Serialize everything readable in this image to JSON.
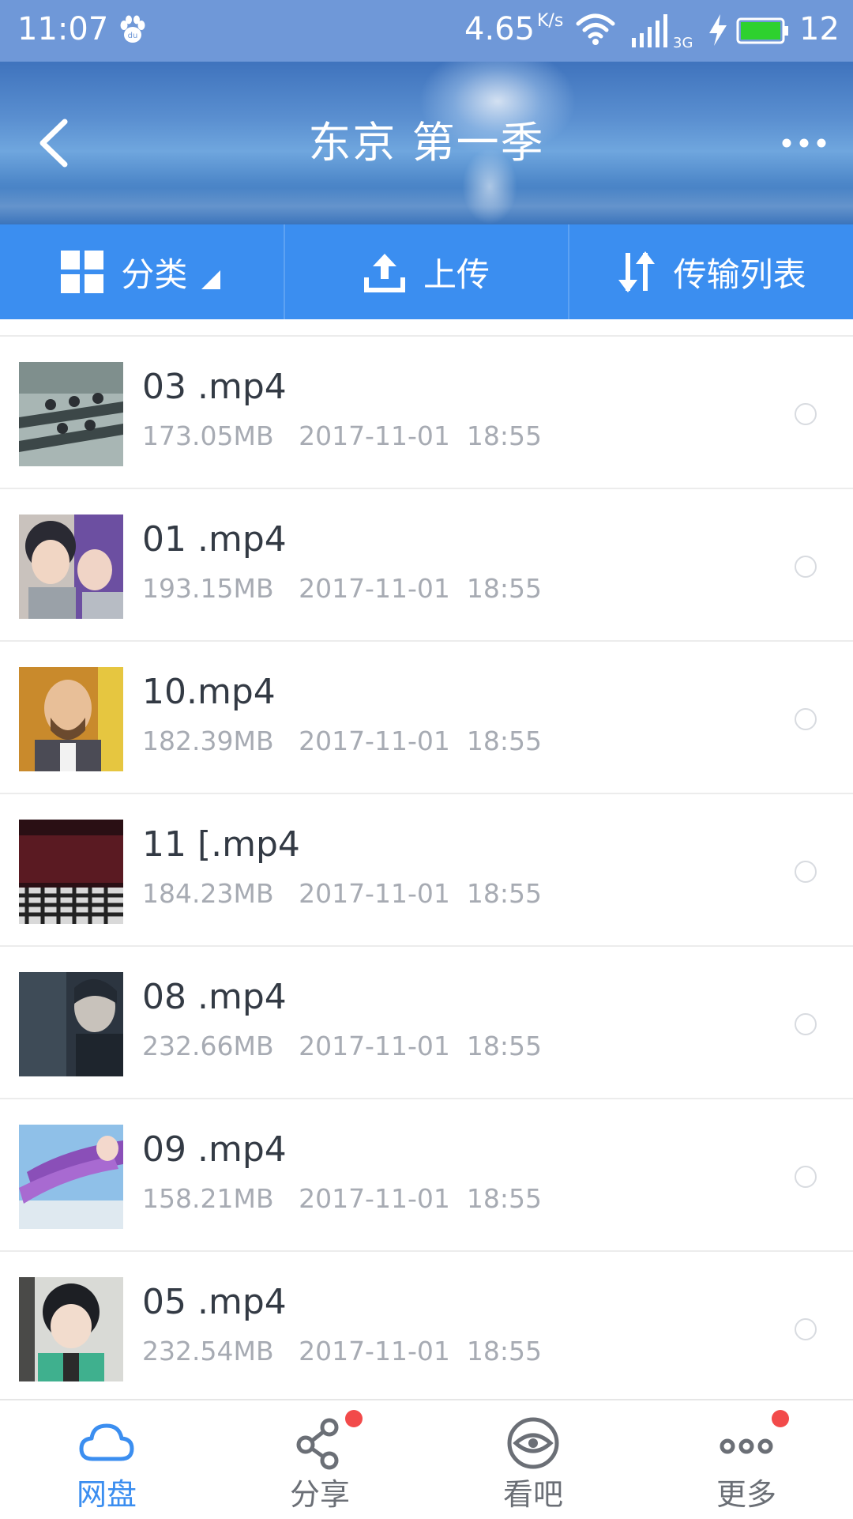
{
  "status_bar": {
    "time": "11:07",
    "net_speed": "4.65",
    "net_unit": "K/s",
    "network_type": "3G",
    "battery_level": "12",
    "icons": [
      "baidu-paw-icon",
      "wifi-icon",
      "signal-icon",
      "charging-icon",
      "battery-icon"
    ]
  },
  "header": {
    "title": "东京 第一季",
    "back_icon": "chevron-left-icon",
    "more_icon": "more-horizontal-icon"
  },
  "toolbar": {
    "category_label": "分类",
    "upload_label": "上传",
    "transfer_label": "传输列表"
  },
  "files": [
    {
      "name": "03 .mp4",
      "size": "173.05MB",
      "date": "2017-11-01",
      "time": "18:55",
      "thumb": "classroom-scene"
    },
    {
      "name": "01 .mp4",
      "size": "193.15MB",
      "date": "2017-11-01",
      "time": "18:55",
      "thumb": "two-characters"
    },
    {
      "name": "10.mp4",
      "size": "182.39MB",
      "date": "2017-11-01",
      "time": "18:55",
      "thumb": "bearded-man"
    },
    {
      "name": "11 [.mp4",
      "size": "184.23MB",
      "date": "2017-11-01",
      "time": "18:55",
      "thumb": "dark-checker-floor"
    },
    {
      "name": "08 .mp4",
      "size": "232.66MB",
      "date": "2017-11-01",
      "time": "18:55",
      "thumb": "dark-figure"
    },
    {
      "name": "09 .mp4",
      "size": "158.21MB",
      "date": "2017-11-01",
      "time": "18:55",
      "thumb": "purple-hair-sky"
    },
    {
      "name": "05 .mp4",
      "size": "232.54MB",
      "date": "2017-11-01",
      "time": "18:55",
      "thumb": "boy-green-hoodie"
    }
  ],
  "bottom_nav": {
    "items": [
      {
        "label": "网盘",
        "icon": "cloud-icon",
        "active": true,
        "badge": false
      },
      {
        "label": "分享",
        "icon": "share-icon",
        "active": false,
        "badge": true
      },
      {
        "label": "看吧",
        "icon": "eye-icon",
        "active": false,
        "badge": false
      },
      {
        "label": "更多",
        "icon": "more-dots-icon",
        "active": false,
        "badge": true
      }
    ]
  },
  "colors": {
    "accent": "#3b8ef0",
    "status_bar": "#6f98d8",
    "badge": "#f24a4a",
    "meta_text": "#a7abb3"
  }
}
